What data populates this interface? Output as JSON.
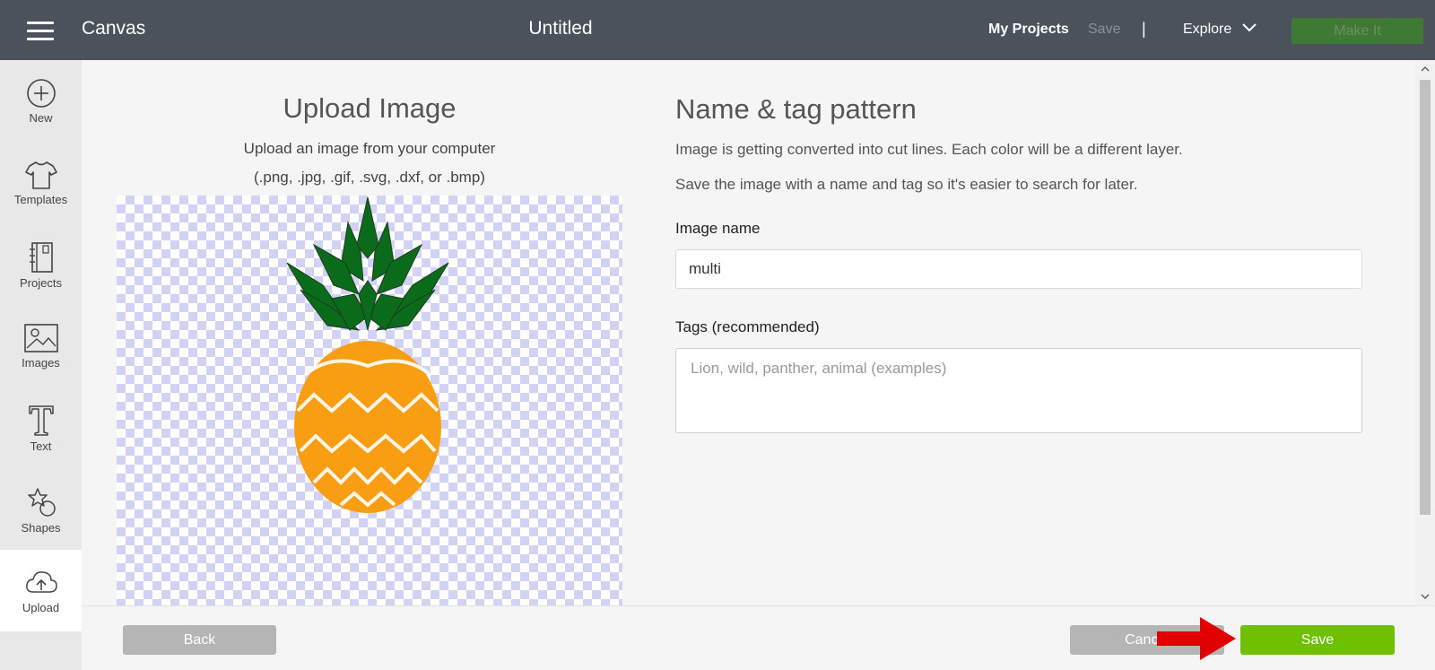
{
  "header": {
    "app_title": "Canvas",
    "doc_title": "Untitled",
    "my_projects": "My Projects",
    "save": "Save",
    "divider": "|",
    "explore": "Explore",
    "make_it": "Make It"
  },
  "sidebar": {
    "items": [
      {
        "label": "New",
        "icon": "plus-circle-icon"
      },
      {
        "label": "Templates",
        "icon": "tshirt-icon"
      },
      {
        "label": "Projects",
        "icon": "notebook-icon"
      },
      {
        "label": "Images",
        "icon": "image-icon"
      },
      {
        "label": "Text",
        "icon": "text-t-icon"
      },
      {
        "label": "Shapes",
        "icon": "shapes-icon"
      },
      {
        "label": "Upload",
        "icon": "cloud-upload-icon",
        "active": true
      }
    ]
  },
  "upload": {
    "title": "Upload Image",
    "subtitle": "Upload an image from your computer",
    "formats": "(.png, .jpg, .gif, .svg, .dxf, or .bmp)"
  },
  "form": {
    "title": "Name & tag pattern",
    "desc1": "Image is getting converted into cut lines. Each color will be a different layer.",
    "desc2": "Save the image with a name and tag so it's easier to search for later.",
    "image_name_label": "Image name",
    "image_name_value": "multi",
    "tags_label": "Tags (recommended)",
    "tags_placeholder": "Lion, wild, panther, animal (examples)"
  },
  "footer": {
    "back": "Back",
    "cancel": "Cancel",
    "save": "Save"
  },
  "colors": {
    "topbar": "#4a535b",
    "save_green": "#6ec000",
    "make_it_green": "#3f7a35",
    "pineapple_leaves": "#0a6b1a",
    "pineapple_body": "#f99d12",
    "arrow_red": "#e00000"
  }
}
